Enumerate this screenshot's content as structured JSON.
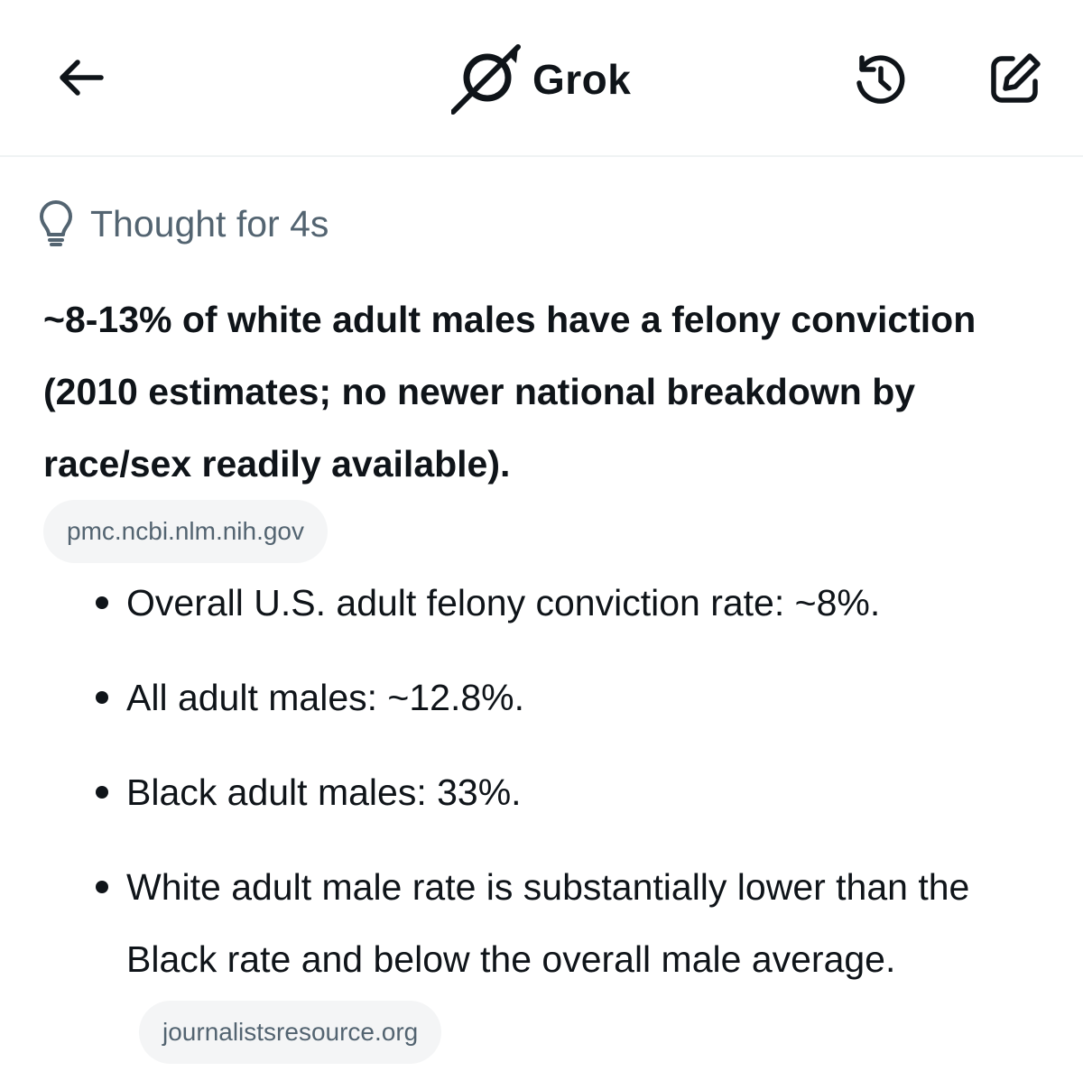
{
  "header": {
    "app_name": "Grok",
    "back_icon": "arrow-left-icon",
    "logo_icon": "grok-logo-icon",
    "history_icon": "history-icon",
    "compose_icon": "compose-icon"
  },
  "thought": {
    "label": "Thought for 4s",
    "icon": "lightbulb-icon"
  },
  "response": {
    "headline": "~8-13% of white adult males have a felony conviction (2010 estimates; no newer national breakdown by race/sex readily available).",
    "source_primary": "pmc.ncbi.nlm.nih.gov",
    "bullets": [
      {
        "text": "Overall U.S. adult felony conviction rate: ~8%."
      },
      {
        "text": "All adult males: ~12.8%."
      },
      {
        "text": "Black adult males: 33%."
      },
      {
        "text": "White adult male rate is substantially lower than the Black rate and below the overall male average.",
        "source": "journalistsresource.org"
      }
    ]
  },
  "colors": {
    "text": "#0f1419",
    "secondary_text": "#536471",
    "chip_bg": "#f4f5f6",
    "divider": "#eff3f4"
  }
}
